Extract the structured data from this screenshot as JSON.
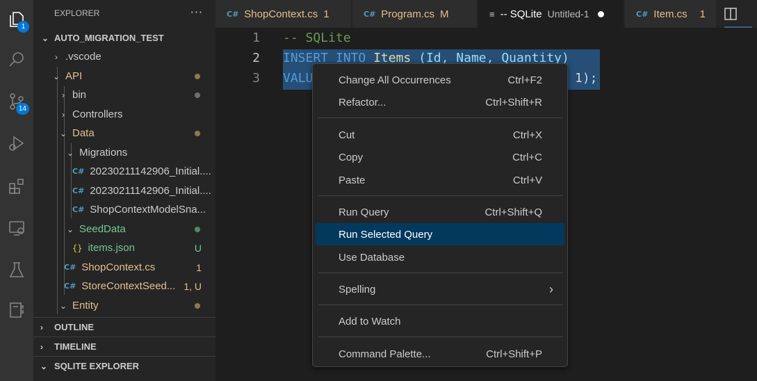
{
  "activity_bar": {
    "explorer_badge": "1",
    "scm_badge": "14"
  },
  "explorer": {
    "title": "EXPLORER",
    "more": "···",
    "root": "AUTO_MIGRATION_TEST",
    "tree": [
      {
        "label": ".vscode",
        "status": ""
      },
      {
        "label": "API",
        "status": ""
      },
      {
        "label": "bin",
        "status": ""
      },
      {
        "label": "Controllers",
        "status": ""
      },
      {
        "label": "Data",
        "status": ""
      },
      {
        "label": "Migrations",
        "status": ""
      },
      {
        "label": "20230211142906_Initial....",
        "status": ""
      },
      {
        "label": "20230211142906_Initial....",
        "status": ""
      },
      {
        "label": "ShopContextModelSna...",
        "status": ""
      },
      {
        "label": "SeedData",
        "status": ""
      },
      {
        "label": "items.json",
        "status": "U"
      },
      {
        "label": "ShopContext.cs",
        "status": "1"
      },
      {
        "label": "StoreContextSeed...",
        "status": "1, U"
      },
      {
        "label": "Entity",
        "status": ""
      }
    ],
    "sections": [
      "OUTLINE",
      "TIMELINE",
      "SQLITE EXPLORER"
    ]
  },
  "tabs": [
    {
      "label": "ShopContext.cs",
      "status": "1"
    },
    {
      "label": "Program.cs",
      "status": "M"
    },
    {
      "label": "-- SQLite",
      "description": "Untitled-1"
    },
    {
      "label": "Item.cs",
      "status": "1"
    }
  ],
  "editor": {
    "line_numbers": [
      "1",
      "2",
      "3"
    ],
    "line1": "-- SQLite",
    "line2_kw1": "INSERT",
    "line2_kw2": "INTO",
    "line2_table": "Items",
    "line2_rest": "(Id, Name, Quantity)",
    "line3_start": "VALU",
    "line3_end": "1);"
  },
  "context_menu": {
    "items": [
      {
        "label": "Change All Occurrences",
        "shortcut": "Ctrl+F2"
      },
      {
        "label": "Refactor...",
        "shortcut": "Ctrl+Shift+R"
      },
      {
        "label": "Cut",
        "shortcut": "Ctrl+X"
      },
      {
        "label": "Copy",
        "shortcut": "Ctrl+C"
      },
      {
        "label": "Paste",
        "shortcut": "Ctrl+V"
      },
      {
        "label": "Run Query",
        "shortcut": "Ctrl+Shift+Q"
      },
      {
        "label": "Run Selected Query",
        "shortcut": ""
      },
      {
        "label": "Use Database",
        "shortcut": ""
      },
      {
        "label": "Spelling",
        "shortcut": ""
      },
      {
        "label": "Add to Watch",
        "shortcut": ""
      },
      {
        "label": "Command Palette...",
        "shortcut": "Ctrl+Shift+P"
      }
    ],
    "highlighted": "Run Selected Query"
  },
  "colors": {
    "modified_folder": "#e2c08d",
    "untracked": "#73c991",
    "keyword": "#569cd6",
    "comment": "#6a9955",
    "identifier": "#9cdcfe",
    "menu_highlight": "#04395e"
  }
}
